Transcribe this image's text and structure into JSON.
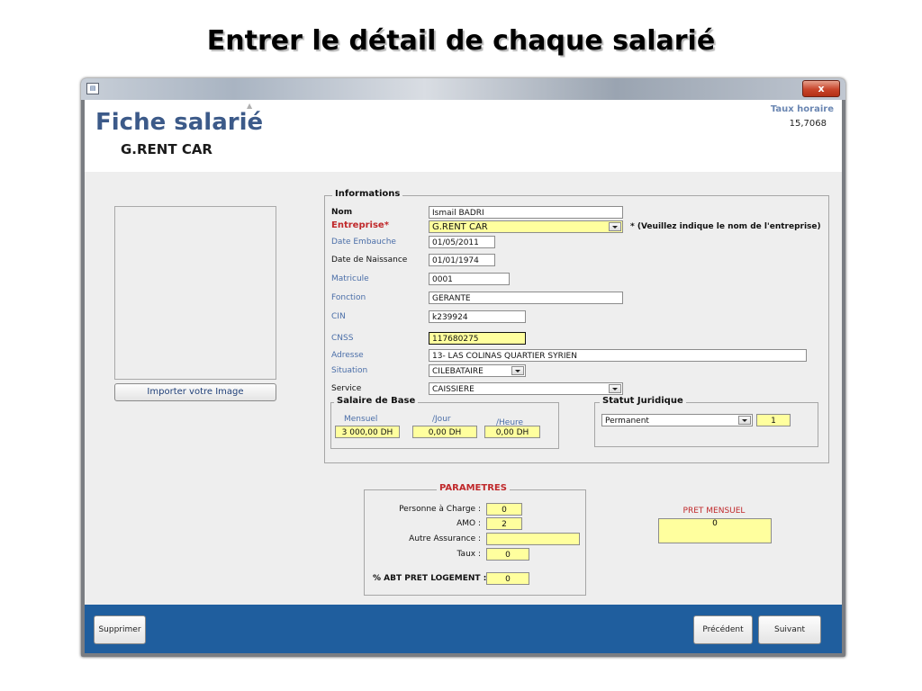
{
  "slide": {
    "title": "Entrer le détail de chaque salarié"
  },
  "window": {
    "close_label": "x",
    "sys_icon": "form-icon"
  },
  "header": {
    "title": "Fiche salarié",
    "company": "G.RENT CAR",
    "taux_label": "Taux horaire",
    "taux_value": "15,7068"
  },
  "photo": {
    "import_button": "Importer votre Image"
  },
  "informations": {
    "legend": "Informations",
    "nom_label": "Nom",
    "nom_value": "Ismail BADRI",
    "entreprise_label": "Entreprise*",
    "entreprise_value": "G.RENT CAR",
    "entreprise_hint": "* (Veuillez indique le nom de l'entreprise)",
    "embauche_label": "Date Embauche",
    "embauche_value": "01/05/2011",
    "naissance_label": "Date de Naissance",
    "naissance_value": "01/01/1974",
    "matricule_label": "Matricule",
    "matricule_value": "0001",
    "fonction_label": "Fonction",
    "fonction_value": "GERANTE",
    "cin_label": "CIN",
    "cin_value": "k239924",
    "cnss_label": "CNSS",
    "cnss_value": "117680275",
    "adresse_label": "Adresse",
    "adresse_value": "13- LAS COLINAS QUARTIER SYRIEN",
    "situation_label": "Situation",
    "situation_value": "CILEBATAIRE",
    "service_label": "Service",
    "service_value": "CAISSIERE"
  },
  "salaire": {
    "legend": "Salaire de Base",
    "mensuel_label": "Mensuel",
    "mensuel_value": "3 000,00 DH",
    "jour_label": "/Jour",
    "jour_value": "0,00 DH",
    "heure_label": "/Heure",
    "heure_value": "0,00 DH"
  },
  "statut": {
    "legend": "Statut Juridique",
    "value": "Permanent",
    "code": "1"
  },
  "parametres": {
    "legend": "PARAMETRES",
    "personne_label": "Personne à Charge :",
    "personne_value": "0",
    "amo_label": "AMO :",
    "amo_value": "2",
    "autre_label": "Autre Assurance :",
    "autre_value": "",
    "taux_label": "Taux :",
    "taux_value": "0",
    "abt_label": "% ABT PRET LOGEMENT :",
    "abt_value": "0"
  },
  "pret": {
    "label": "PRET MENSUEL",
    "value": "0"
  },
  "footer": {
    "delete": "Supprimer",
    "previous": "Précédent",
    "next": "Suivant"
  },
  "colors": {
    "title_blue": "#3c5a89",
    "footer_blue": "#1f5e9e",
    "field_yellow": "#ffff9e",
    "required_red": "#c0292b"
  }
}
